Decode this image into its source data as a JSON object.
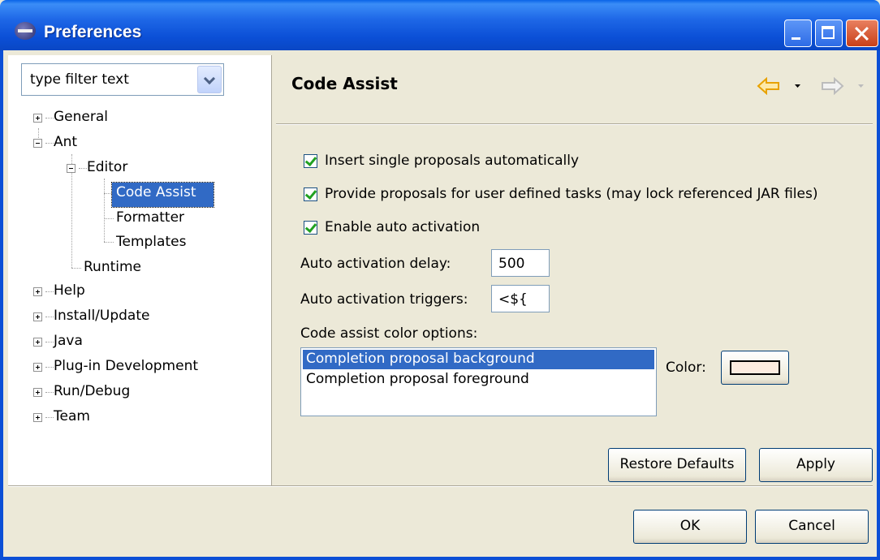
{
  "window": {
    "title": "Preferences"
  },
  "filter": {
    "placeholder": "type filter text"
  },
  "tree": {
    "general": "General",
    "ant": "Ant",
    "editor": "Editor",
    "code_assist": "Code Assist",
    "formatter": "Formatter",
    "templates": "Templates",
    "runtime": "Runtime",
    "help": "Help",
    "install_update": "Install/Update",
    "java": "Java",
    "plugin_development": "Plug-in Development",
    "run_debug": "Run/Debug",
    "team": "Team"
  },
  "page": {
    "title": "Code Assist",
    "insert_single_label": "Insert single proposals automatically",
    "provide_proposals_label": "Provide proposals for user defined tasks (may lock referenced JAR files)",
    "enable_auto_activation_label": "Enable auto activation",
    "delay_label": "Auto activation delay:",
    "delay_value": "500",
    "triggers_label": "Auto activation triggers:",
    "triggers_value": "<${",
    "color_options_label": "Code assist color options:",
    "color_options": [
      "Completion proposal background",
      "Completion proposal foreground"
    ],
    "color_label": "Color:",
    "swatch_color": "#fcece0",
    "restore_defaults": "Restore Defaults",
    "apply": "Apply"
  },
  "dialog": {
    "ok": "OK",
    "cancel": "Cancel"
  },
  "colors": {
    "titlebar": "#0b4fd6",
    "selection": "#316ac5",
    "face": "#ece9d8",
    "back_arrow": "#e8a200"
  }
}
